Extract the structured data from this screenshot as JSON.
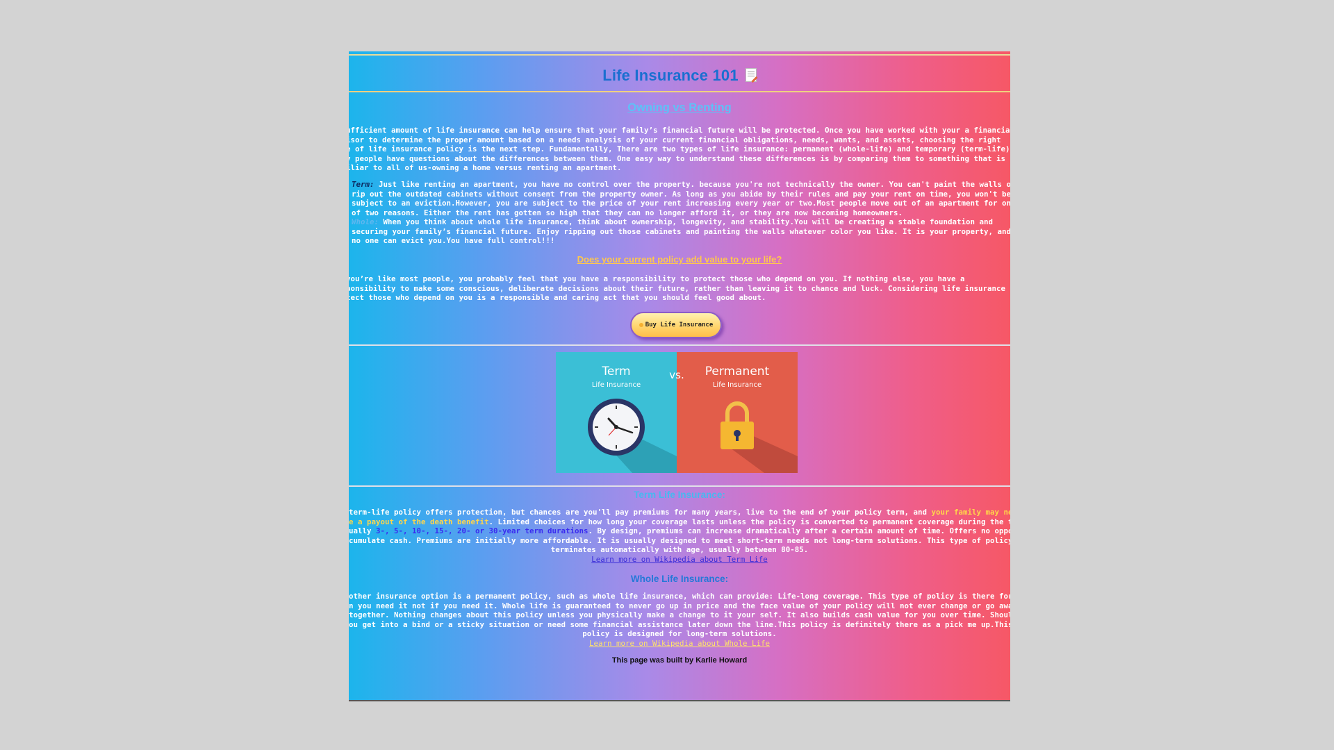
{
  "title": "Life Insurance 101",
  "headings": {
    "owning": "Owning vs Renting",
    "policy": "Does your current policy add value to your life?",
    "term": "Term Life Insurance:",
    "whole": "Whole Life Insurance:"
  },
  "intro_lines": [
    "ufficient amount of life insurance can help ensure that your family’s financial future will be protected. Once you have worked with your a financial",
    "isor to determine the proper amount based on a needs analysis of your current financial obligations, needs, wants, and assets, choosing the right",
    "e of life insurance policy is the next step. Fundamentally, There are two types of life insurance: permanent (whole-life) and temporary (term-life)",
    "y people have questions about the differences between them. One easy way to understand these differences is by comparing them to something that is",
    "iliar to all of us-owning a home versus renting an apartment."
  ],
  "term_label": "Term:",
  "term_lines": [
    " Just like renting an apartment, you have no control over the property. because you're not technically the owner. You can't paint the walls or",
    "rip out the outdated cabinets without consent from the property owner. As long as you abide by their rules and pay your rent on time, you won't be",
    "subject to an eviction.However, you are subject to the price of your rent increasing every year or two.Most people move out of an apartment for one",
    "of two reasons. Either the rent has gotten so high that they can no longer afford it, or they are now becoming homeowners."
  ],
  "whole_label": "Whole:",
  "whole_lines": [
    " When you think about whole life insurance, think about ownership, longevity, and stability.You will be creating a stable foundation and",
    "securing your family’s financial future. Enjoy ripping out those cabinets and painting the walls whatever color you like. It is your property, and",
    "no one can evict you.You have full control!!!"
  ],
  "value_lines": [
    "you’re like most people, you probably feel that you have a responsibility to protect those who depend on you. If nothing else, you have a",
    "ponsibility to make some conscious, deliberate decisions about their future, rather than leaving it to chance and luck. Considering life insurance to",
    "tect those who depend on you is a responsible and caring act that you should feel good about."
  ],
  "buy_button": "Buy Life Insurance",
  "illustration": {
    "term_title": "Term",
    "term_sub": "Life Insurance",
    "vs": "vs.",
    "perm_title": "Permanent",
    "perm_sub": "Life Insurance"
  },
  "term_section": {
    "line1_a": "term-life policy offers protection, but chances are you'll pay premiums for many years, live to the end of your policy term, and ",
    "line1_b": "your family may never",
    "line2_a": "e a payout of the death benefit",
    "line2_b": ". Limited choices for how long your coverage lasts unless the policy is converted to permanent coverage during the term —",
    "line3_a": "ually ",
    "line3_b": "3-, 5-, 10-, 15-, 20- or 30-year term durations",
    "line3_c": ". By design, premiums can increase dramatically after a certain amount of time. Offers no opportunity to",
    "line4": "cumulate cash. Premiums are initially more affordable. It is usually designed to meet short-term needs not long-term solutions. This type of policy",
    "line5": "terminates automatically with age, usually between 80-85.",
    "link": "Learn more on Wikipedia about Term Life"
  },
  "whole_section": {
    "lines": [
      "other insurance option is a permanent policy, such as whole life insurance, which can provide: Life-long coverage. This type of policy is there for",
      "n you need it not if you need it. Whole life is guaranteed to never go up in price and the face value of your policy will not ever change or go away",
      "together. Nothing changes about this policy unless you physically make a change to it your self. It also builds cash value for you over time. Should",
      "ou get into a bind or a sticky situation or need some financial assistance later down the line.This policy is definitely there as a pick me up.This",
      "policy is designed for long-term solutions."
    ],
    "link": "Learn more on Wikipedia about Whole Life"
  },
  "footer": "This page was built by Karlie Howard"
}
